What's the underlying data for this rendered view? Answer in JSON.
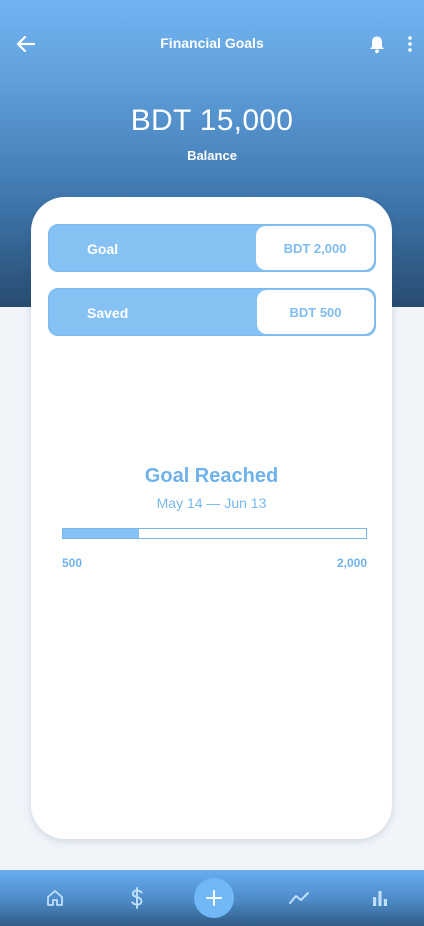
{
  "header": {
    "title": "Financial Goals",
    "back_icon": "arrow-left-icon",
    "bell_icon": "bell-icon",
    "more_icon": "more-vertical-icon"
  },
  "balance": {
    "amount": "BDT 15,000",
    "label": "Balance"
  },
  "goal_card": {
    "goal_label": "Goal",
    "goal_value": "BDT 2,000",
    "saved_label": "Saved",
    "saved_value": "BDT 500",
    "status": "Goal Reached",
    "date_range": "May 14 — Jun 13",
    "progress_fraction": 0.25,
    "progress_min": "500",
    "progress_max": "2,000"
  },
  "bottom_nav": {
    "items": [
      "home-icon",
      "dollar-icon",
      "plus-icon",
      "trend-icon",
      "bar-chart-icon"
    ]
  },
  "colors": {
    "accent": "#85c1f3",
    "text_accent": "#6fb2ea",
    "header_top": "#72b5f2",
    "header_bottom": "#274c70"
  }
}
